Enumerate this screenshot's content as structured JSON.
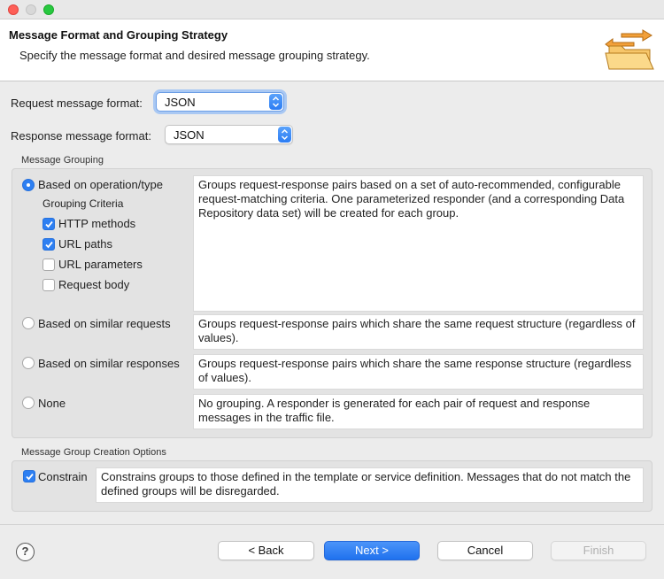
{
  "header": {
    "title": "Message Format and Grouping Strategy",
    "description": "Specify the message format and desired message grouping strategy."
  },
  "formats": {
    "request_label": "Request message format:",
    "request_value": "JSON",
    "response_label": "Response message format:",
    "response_value": "JSON"
  },
  "grouping": {
    "title": "Message Grouping",
    "options": [
      {
        "label": "Based on operation/type",
        "selected": true,
        "description": "Groups request-response pairs based on a set of auto-recommended, configurable request-matching criteria. One parameterized responder (and a corresponding Data Repository data set) will be created for each group."
      },
      {
        "label": "Based on similar requests",
        "selected": false,
        "description": "Groups request-response pairs which share the same request structure (regardless of values)."
      },
      {
        "label": "Based on similar responses",
        "selected": false,
        "description": "Groups request-response pairs which share the same response structure (regardless of values)."
      },
      {
        "label": "None",
        "selected": false,
        "description": "No grouping. A responder is generated for each pair of request and response messages in the traffic file."
      }
    ],
    "criteria_title": "Grouping Criteria",
    "criteria": [
      {
        "label": "HTTP methods",
        "checked": true
      },
      {
        "label": "URL paths",
        "checked": true
      },
      {
        "label": "URL parameters",
        "checked": false
      },
      {
        "label": "Request body",
        "checked": false
      }
    ]
  },
  "creation": {
    "title": "Message Group Creation Options",
    "constrain_label": "Constrain",
    "constrain_checked": true,
    "constrain_description": "Constrains groups to those defined in the template or service definition. Messages that do not match the defined groups will be disregarded."
  },
  "buttons": {
    "help": "?",
    "back": "< Back",
    "next": "Next >",
    "cancel": "Cancel",
    "finish": "Finish"
  },
  "colors": {
    "accent": "#2d7ff2",
    "window_background": "#ececec",
    "group_background": "#e3e3e3"
  },
  "icons": {
    "header_icon": "open-folder-icon",
    "select_arrow": "updown-chevron-icon",
    "check": "checkmark-icon"
  }
}
